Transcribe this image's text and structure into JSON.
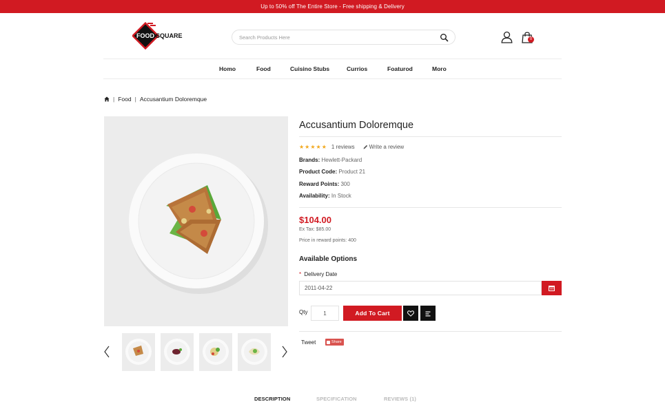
{
  "promo": {
    "text": "Up to 50% off The Entire Store - Free shipping & Delivery"
  },
  "logo": {
    "text_line1": "FOOD",
    "text_line2": "SQUARE",
    "brand_color": "#d11a22"
  },
  "search": {
    "placeholder": "Search Products Here",
    "icon": "search-icon"
  },
  "header": {
    "account_icon": "user-icon",
    "cart_icon": "shopping-bag-icon",
    "cart_count": "0"
  },
  "nav": {
    "items": [
      {
        "label": "Homo"
      },
      {
        "label": "Food"
      },
      {
        "label": "Cuisino Stubs"
      },
      {
        "label": "Currios"
      },
      {
        "label": "Foaturod"
      },
      {
        "label": "Moro"
      }
    ]
  },
  "breadcrumb": {
    "home_icon": "home-icon",
    "category": "Food",
    "current": "Accusantium Doloremque"
  },
  "product": {
    "title": "Accusantium Doloremque",
    "rating": {
      "stars": 5,
      "reviews_text": "1 reviews",
      "write_review": "Write a review"
    },
    "specs": {
      "brand_label": "Brands:",
      "brand_value": "Hewlett-Packard",
      "code_label": "Product Code:",
      "code_value": "Product 21",
      "reward_label": "Reward Points:",
      "reward_value": "300",
      "availability_label": "Availability:",
      "availability_value": "In Stock"
    },
    "price": "$104.00",
    "ex_tax": "Ex Tax: $85.00",
    "reward_price": "Price in reward points: 400",
    "options": {
      "title": "Available Options",
      "delivery_label": "Delivery Date",
      "required_mark": "*",
      "delivery_value": "2011-04-22",
      "calendar_icon": "calendar-icon"
    },
    "qty_label": "Qty",
    "qty_value": "1",
    "add_to_cart": "Add To Cart",
    "wishlist_icon": "heart-icon",
    "compare_icon": "compare-icon",
    "tweet": "Tweet",
    "share": "Share"
  },
  "gallery": {
    "prev_icon": "chevron-left-icon",
    "next_icon": "chevron-right-icon",
    "thumb_count": 4
  },
  "tabs": [
    {
      "label": "DESCRIPTION",
      "active": true
    },
    {
      "label": "SPECIFICATION",
      "active": false
    },
    {
      "label": "REVIEWS (1)",
      "active": false
    }
  ],
  "colors": {
    "accent": "#d11a22",
    "dark": "#111111",
    "star": "#f2a81d",
    "image_bg": "#ececec"
  }
}
